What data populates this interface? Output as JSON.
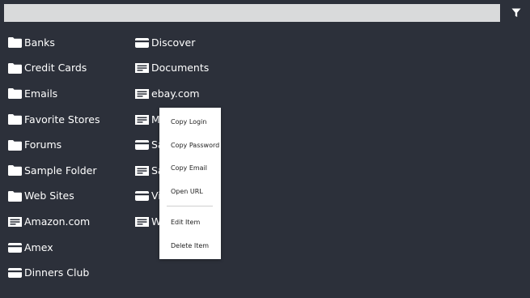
{
  "search": {
    "placeholder": "",
    "value": ""
  },
  "toolbar": {
    "filter_icon": "filter-icon"
  },
  "columns": [
    [
      {
        "label": "Banks",
        "icon": "folder-icon"
      },
      {
        "label": "Credit Cards",
        "icon": "folder-icon"
      },
      {
        "label": "Emails",
        "icon": "folder-icon"
      },
      {
        "label": "Favorite Stores",
        "icon": "folder-icon"
      },
      {
        "label": "Forums",
        "icon": "folder-icon"
      },
      {
        "label": "Sample Folder",
        "icon": "folder-icon"
      },
      {
        "label": "Web Sites",
        "icon": "folder-icon"
      },
      {
        "label": "Amazon.com",
        "icon": "login-item-icon"
      },
      {
        "label": "Amex",
        "icon": "card-item-icon"
      },
      {
        "label": "Dinners Club",
        "icon": "card-item-icon"
      }
    ],
    [
      {
        "label": "Discover",
        "icon": "card-item-icon"
      },
      {
        "label": "Documents",
        "icon": "login-item-icon"
      },
      {
        "label": "ebay.com",
        "icon": "login-item-icon"
      },
      {
        "label": "M",
        "icon": "login-item-icon"
      },
      {
        "label": "Sa",
        "icon": "card-item-icon"
      },
      {
        "label": "Sa",
        "icon": "login-item-icon"
      },
      {
        "label": "Vi",
        "icon": "card-item-icon"
      },
      {
        "label": "W",
        "icon": "login-item-icon"
      }
    ]
  ],
  "context_menu": {
    "items": [
      {
        "label": "Copy Login"
      },
      {
        "label": "Copy Password"
      },
      {
        "label": "Copy Email"
      },
      {
        "label": "Open URL"
      },
      {
        "label": "Edit Item"
      },
      {
        "label": "Delete Item"
      }
    ]
  },
  "colors": {
    "background": "#2c303a",
    "search_bg": "#d9dadb",
    "text": "#ffffff",
    "menu_bg": "#ffffff"
  }
}
